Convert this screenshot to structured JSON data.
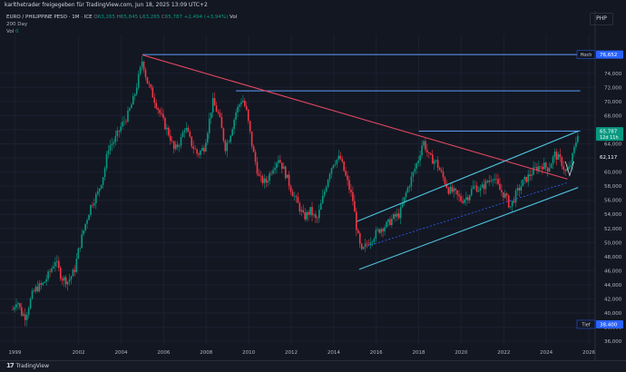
{
  "header": {
    "text": "karlthetrader freigegeben für TradingView.com, Jun 18, 2025 13:09 UTC+2",
    "currency": "PHP"
  },
  "legend": {
    "symbol": "EURO / PHILIPPINE PESO · 1M · ICE",
    "o_key": "O",
    "o": "63,265",
    "h_key": "H",
    "h": "65,845",
    "l_key": "L",
    "l": "63,265",
    "c_key": "C",
    "c": "65,787",
    "change": "+2,494 (+3,94%)",
    "vol_label": "Vol",
    "ma_label": "200 Day",
    "vol_row_label": "Vol",
    "vol_value": "0"
  },
  "footer": {
    "brand": "TradingView",
    "logo": "17"
  },
  "chart_data": {
    "type": "candlestick",
    "y_axis": {
      "ylim": [
        35.5,
        79.5
      ],
      "ticks": [
        "74,000",
        "72,000",
        "70,000",
        "68,000",
        "66,000",
        "64,000",
        "62,000",
        "60,000",
        "58,000",
        "56,000",
        "54,000",
        "52,000",
        "50,000",
        "48,000",
        "46,000",
        "44,000",
        "42,000",
        "40,000",
        "38,000",
        "36,000"
      ],
      "tick_values": [
        74,
        72,
        70,
        68,
        66,
        64,
        62,
        60,
        58,
        56,
        54,
        52,
        50,
        48,
        46,
        44,
        42,
        40,
        38,
        36
      ]
    },
    "x_axis": {
      "xlim": [
        1998.3,
        2026.3
      ],
      "ticks": [
        "1999",
        "2002",
        "2004",
        "2006",
        "2008",
        "2010",
        "2012",
        "2014",
        "2016",
        "2018",
        "2020",
        "2022",
        "2024",
        "2026"
      ],
      "tick_values": [
        1999,
        2002,
        2004,
        2006,
        2008,
        2010,
        2012,
        2014,
        2016,
        2018,
        2020,
        2022,
        2024,
        2026
      ]
    },
    "price_labels": [
      {
        "name": "Hoch",
        "value": 76.652,
        "text": "76,652",
        "color": "#2962ff"
      },
      {
        "name": "",
        "value": 65.787,
        "text": "65,787",
        "sub": "12d 11h",
        "color": "#089981"
      },
      {
        "name": "",
        "value": 62.117,
        "text": "62,117",
        "color": "#131722"
      },
      {
        "name": "Tief",
        "value": 38.4,
        "text": "38,400",
        "color": "#2962ff"
      }
    ],
    "close_path": [
      [
        1998.9,
        40.5
      ],
      [
        1999.1,
        42.0
      ],
      [
        1999.3,
        40.0
      ],
      [
        1999.5,
        39.5
      ],
      [
        1999.8,
        42.5
      ],
      [
        2000.0,
        43.5
      ],
      [
        2000.3,
        44.0
      ],
      [
        2000.6,
        45.5
      ],
      [
        2000.9,
        47.5
      ],
      [
        2001.2,
        45.0
      ],
      [
        2001.5,
        44.5
      ],
      [
        2001.8,
        46.0
      ],
      [
        2002.0,
        49.0
      ],
      [
        2002.3,
        52.5
      ],
      [
        2002.6,
        55.5
      ],
      [
        2002.9,
        57.0
      ],
      [
        2003.2,
        60.0
      ],
      [
        2003.4,
        63.5
      ],
      [
        2003.7,
        64.5
      ],
      [
        2004.0,
        66.5
      ],
      [
        2004.3,
        68.0
      ],
      [
        2004.6,
        70.5
      ],
      [
        2004.9,
        74.5
      ],
      [
        2005.0,
        76.0
      ],
      [
        2005.2,
        73.0
      ],
      [
        2005.4,
        71.5
      ],
      [
        2005.6,
        70.0
      ],
      [
        2005.8,
        68.5
      ],
      [
        2006.0,
        67.0
      ],
      [
        2006.3,
        65.0
      ],
      [
        2006.5,
        63.0
      ],
      [
        2006.8,
        64.5
      ],
      [
        2007.0,
        66.5
      ],
      [
        2007.3,
        64.0
      ],
      [
        2007.6,
        62.5
      ],
      [
        2007.9,
        63.5
      ],
      [
        2008.1,
        66.5
      ],
      [
        2008.3,
        70.0
      ],
      [
        2008.6,
        68.0
      ],
      [
        2008.9,
        63.5
      ],
      [
        2009.1,
        65.0
      ],
      [
        2009.4,
        68.5
      ],
      [
        2009.7,
        70.5
      ],
      [
        2009.9,
        68.5
      ],
      [
        2010.2,
        63.0
      ],
      [
        2010.5,
        59.0
      ],
      [
        2010.8,
        58.5
      ],
      [
        2011.1,
        60.5
      ],
      [
        2011.4,
        62.0
      ],
      [
        2011.7,
        60.0
      ],
      [
        2012.0,
        57.5
      ],
      [
        2012.3,
        55.5
      ],
      [
        2012.6,
        53.5
      ],
      [
        2012.9,
        54.5
      ],
      [
        2013.2,
        53.0
      ],
      [
        2013.5,
        56.5
      ],
      [
        2013.8,
        60.0
      ],
      [
        2014.0,
        61.5
      ],
      [
        2014.3,
        62.0
      ],
      [
        2014.6,
        59.0
      ],
      [
        2014.9,
        56.0
      ],
      [
        2015.1,
        51.5
      ],
      [
        2015.3,
        48.5
      ],
      [
        2015.6,
        50.0
      ],
      [
        2015.9,
        51.0
      ],
      [
        2016.2,
        52.0
      ],
      [
        2016.5,
        52.5
      ],
      [
        2016.8,
        53.5
      ],
      [
        2017.1,
        54.0
      ],
      [
        2017.4,
        57.0
      ],
      [
        2017.7,
        59.5
      ],
      [
        2018.0,
        62.0
      ],
      [
        2018.2,
        64.5
      ],
      [
        2018.5,
        62.0
      ],
      [
        2018.8,
        61.5
      ],
      [
        2019.1,
        59.5
      ],
      [
        2019.4,
        57.5
      ],
      [
        2019.7,
        57.0
      ],
      [
        2020.0,
        56.0
      ],
      [
        2020.3,
        56.5
      ],
      [
        2020.6,
        58.0
      ],
      [
        2020.9,
        57.5
      ],
      [
        2021.2,
        58.5
      ],
      [
        2021.5,
        59.5
      ],
      [
        2021.8,
        57.5
      ],
      [
        2022.1,
        56.5
      ],
      [
        2022.3,
        55.0
      ],
      [
        2022.6,
        57.0
      ],
      [
        2022.9,
        58.5
      ],
      [
        2023.2,
        59.5
      ],
      [
        2023.5,
        60.5
      ],
      [
        2023.8,
        61.0
      ],
      [
        2024.1,
        60.5
      ],
      [
        2024.4,
        62.5
      ],
      [
        2024.7,
        61.5
      ],
      [
        2024.9,
        60.0
      ],
      [
        2025.1,
        60.5
      ],
      [
        2025.3,
        63.0
      ],
      [
        2025.5,
        65.8
      ]
    ],
    "ma_path": [
      [
        2005.0,
        51.0
      ],
      [
        2007.0,
        55.0
      ],
      [
        2009.0,
        58.5
      ],
      [
        2011.0,
        60.5
      ],
      [
        2013.0,
        61.0
      ],
      [
        2015.0,
        58.5
      ],
      [
        2017.0,
        57.5
      ],
      [
        2019.0,
        57.5
      ],
      [
        2021.0,
        57.5
      ],
      [
        2023.0,
        58.0
      ],
      [
        2025.5,
        58.5
      ]
    ],
    "drawings": {
      "resistance_lines": [
        {
          "color": "#5b9cf6",
          "x1": 2005.0,
          "x2": 2026.3,
          "y": 76.65
        },
        {
          "color": "#5b9cf6",
          "x1": 2009.4,
          "x2": 2025.6,
          "y": 71.5
        },
        {
          "color": "#5b9cf6",
          "x1": 2018.0,
          "x2": 2025.6,
          "y": 65.8
        }
      ],
      "trendline": {
        "color": "#e0475f",
        "points": [
          [
            2005.0,
            76.6
          ],
          [
            2025.0,
            59.0
          ]
        ]
      },
      "channel": {
        "color": "#4dc3dc",
        "lines": [
          [
            [
              2015.1,
              53.0
            ],
            [
              2025.5,
              65.8
            ]
          ],
          [
            [
              2015.2,
              46.2
            ],
            [
              2025.5,
              57.8
            ]
          ]
        ]
      },
      "dashed_mid": {
        "color": "#2962ff",
        "points": [
          [
            2015.6,
            49.5
          ],
          [
            2025.0,
            58.5
          ]
        ]
      },
      "small_bracket": {
        "color": "#d1d4dc",
        "points": [
          [
            2024.9,
            61.5
          ],
          [
            2025.1,
            59.5
          ],
          [
            2025.3,
            61.5
          ]
        ]
      }
    }
  }
}
